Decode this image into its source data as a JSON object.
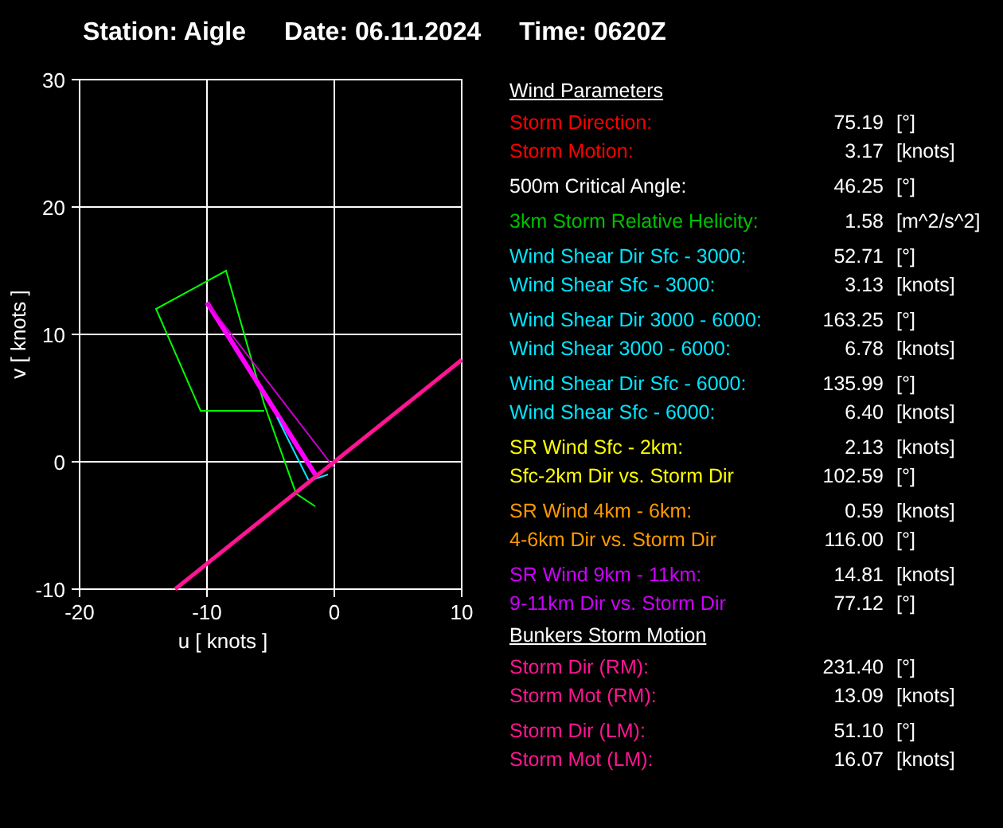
{
  "header": [
    {
      "label": "Station:",
      "value": "Aigle"
    },
    {
      "label": "Date:",
      "value": "06.11.2024"
    },
    {
      "label": "Time:",
      "value": "0620Z"
    }
  ],
  "hodograph": {
    "chart_data": {
      "type": "line",
      "xlabel": "u  [ knots ]",
      "ylabel": "v  [ knots ]",
      "xlim": [
        -20,
        10
      ],
      "ylim": [
        -10,
        30
      ],
      "xticks": [
        -20,
        -10,
        0,
        10
      ],
      "yticks": [
        -10,
        0,
        10,
        20,
        30
      ],
      "grid": true,
      "series": [
        {
          "color": "#00ff00",
          "x": [
            -1.5,
            -3,
            -5.5,
            -8.5,
            -14,
            -10.5,
            -5.5
          ],
          "values": [
            -3.5,
            -2.5,
            4.5,
            15,
            12,
            4,
            4
          ]
        },
        {
          "color": "#ff00ff",
          "x": [
            -1.5,
            -10
          ],
          "values": [
            -1,
            12.5
          ]
        },
        {
          "color": "#cc00cc",
          "x": [
            -10,
            0
          ],
          "values": [
            12.5,
            -0.5
          ]
        },
        {
          "color": "#00e5ff",
          "x": [
            -4.5,
            -2,
            -0.5
          ],
          "values": [
            3.5,
            -1.5,
            -1
          ]
        },
        {
          "color": "#ff1493",
          "x": [
            -12.5,
            10
          ],
          "values": [
            -10,
            8
          ]
        }
      ]
    }
  },
  "sections": [
    {
      "title": "Wind Parameters",
      "groups": [
        [
          {
            "label": "Storm Direction:",
            "value": "75.19",
            "unit": "[°]",
            "color": "#ff0000"
          },
          {
            "label": "Storm Motion:",
            "value": "3.17",
            "unit": "[knots]",
            "color": "#ff0000"
          }
        ],
        [
          {
            "label": "500m Critical Angle:",
            "value": "46.25",
            "unit": "[°]",
            "color": "#ffffff"
          }
        ],
        [
          {
            "label": "3km Storm Relative Helicity:",
            "value": "1.58",
            "unit": "[m^2/s^2]",
            "color": "#00c000"
          }
        ],
        [
          {
            "label": "Wind Shear Dir Sfc - 3000:",
            "value": "52.71",
            "unit": "[°]",
            "color": "#00e5ff"
          },
          {
            "label": "Wind Shear Sfc - 3000:",
            "value": "3.13",
            "unit": "[knots]",
            "color": "#00e5ff"
          }
        ],
        [
          {
            "label": "Wind Shear Dir 3000 - 6000:",
            "value": "163.25",
            "unit": "[°]",
            "color": "#00e5ff"
          },
          {
            "label": "Wind Shear 3000 - 6000:",
            "value": "6.78",
            "unit": "[knots]",
            "color": "#00e5ff"
          }
        ],
        [
          {
            "label": "Wind Shear Dir Sfc - 6000:",
            "value": "135.99",
            "unit": "[°]",
            "color": "#00e5ff"
          },
          {
            "label": "Wind Shear Sfc - 6000:",
            "value": "6.40",
            "unit": "[knots]",
            "color": "#00e5ff"
          }
        ],
        [
          {
            "label": "SR Wind Sfc - 2km:",
            "value": "2.13",
            "unit": "[knots]",
            "color": "#ffff00"
          },
          {
            "label": "Sfc-2km Dir vs. Storm Dir",
            "value": "102.59",
            "unit": "[°]",
            "color": "#ffff00"
          }
        ],
        [
          {
            "label": "SR Wind 4km - 6km:",
            "value": "0.59",
            "unit": "[knots]",
            "color": "#ff9900"
          },
          {
            "label": "4-6km Dir vs. Storm Dir",
            "value": "116.00",
            "unit": "[°]",
            "color": "#ff9900"
          }
        ],
        [
          {
            "label": "SR Wind 9km - 11km:",
            "value": "14.81",
            "unit": "[knots]",
            "color": "#cc00ff"
          },
          {
            "label": "9-11km Dir vs. Storm Dir",
            "value": "77.12",
            "unit": "[°]",
            "color": "#cc00ff"
          }
        ]
      ]
    },
    {
      "title": "Bunkers Storm Motion",
      "groups": [
        [
          {
            "label": "Storm Dir (RM):",
            "value": "231.40",
            "unit": "[°]",
            "color": "#ff1493"
          },
          {
            "label": "Storm Mot (RM):",
            "value": "13.09",
            "unit": "[knots]",
            "color": "#ff1493"
          }
        ],
        [
          {
            "label": "Storm Dir (LM):",
            "value": "51.10",
            "unit": "[°]",
            "color": "#ff1493"
          },
          {
            "label": "Storm Mot (LM):",
            "value": "16.07",
            "unit": "[knots]",
            "color": "#ff1493"
          }
        ]
      ]
    }
  ]
}
